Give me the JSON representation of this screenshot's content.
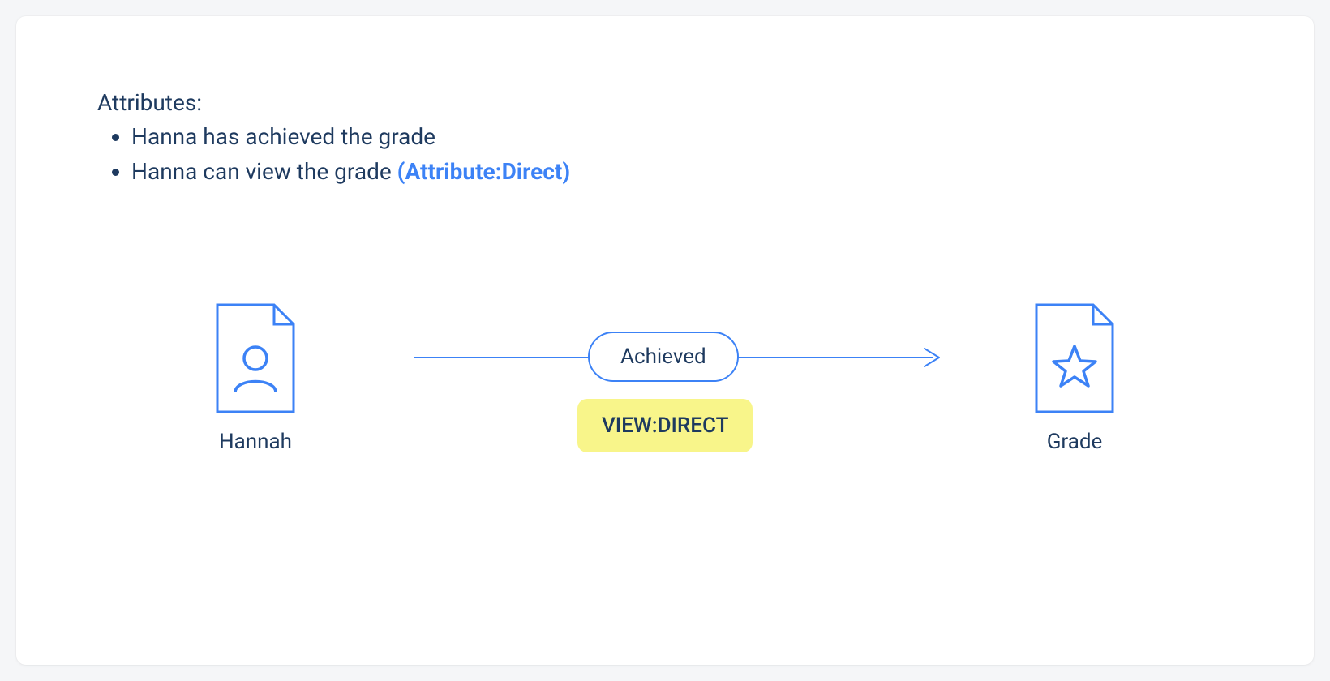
{
  "attributes": {
    "heading": "Attributes:",
    "items": [
      {
        "text": "Hanna has achieved the grade",
        "annotation": ""
      },
      {
        "text": "Hanna can view the grade ",
        "annotation": "(Attribute:Direct)"
      }
    ]
  },
  "diagram": {
    "left_node": {
      "label": "Hannah",
      "icon": "person-document-icon"
    },
    "right_node": {
      "label": "Grade",
      "icon": "star-document-icon"
    },
    "relation_label": "Achieved",
    "highlight_label": "VIEW:DIRECT"
  },
  "colors": {
    "primary_blue": "#3c82f6",
    "text_dark": "#1e3a5f",
    "highlight_yellow": "#f8f58a"
  }
}
